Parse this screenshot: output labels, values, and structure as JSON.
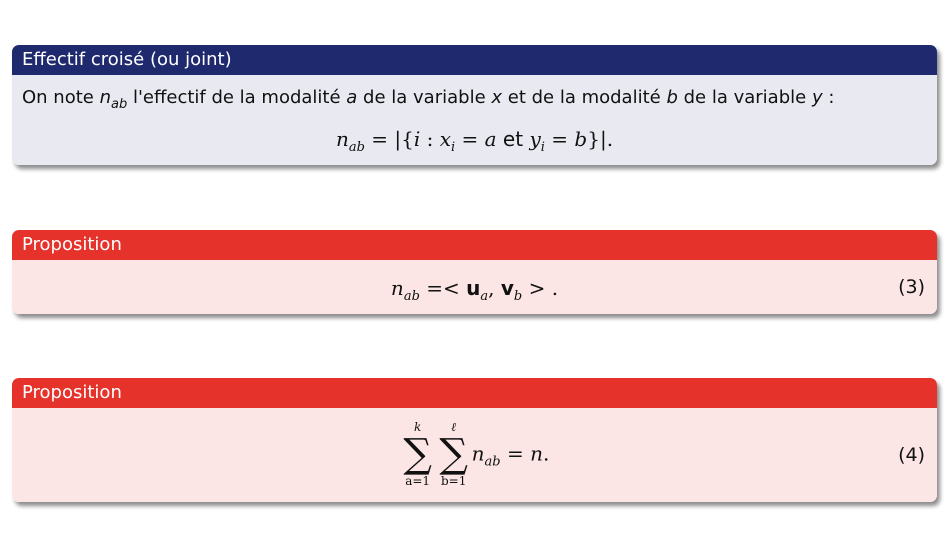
{
  "definition": {
    "title": "Effectif croisé (ou joint)",
    "intro": {
      "p1": "On note ",
      "n": "n",
      "ab": "ab",
      "p2": " l'effectif de la modalité ",
      "a": "a",
      "p3": " de la variable ",
      "x": "x",
      "p4": " et de la modalité ",
      "b": "b",
      "p5": " de la variable ",
      "y": "y",
      "p6": " :"
    },
    "formula": {
      "n": "n",
      "ab": "ab",
      "p1": " = |{",
      "i": "i",
      "p2": " : ",
      "x": "x",
      "i2": "i",
      "p3": " = ",
      "a": "a",
      "et": " et ",
      "y": "y",
      "i3": "i",
      "p4": " = ",
      "b": "b",
      "p5": "}|."
    }
  },
  "proposition1": {
    "title": "Proposition",
    "formula": {
      "n": "n",
      "ab": "ab",
      "p1": " =< ",
      "u": "u",
      "a": "a",
      "comma": ", ",
      "v": "v",
      "b": "b",
      "p2": " > ."
    },
    "number": "(3)"
  },
  "proposition2": {
    "title": "Proposition",
    "formula": {
      "sum1_top": "k",
      "sum1_bottom": "a=1",
      "sum2_top": "ℓ",
      "sum2_bottom": "b=1",
      "sigma": "∑",
      "n": "n",
      "ab": "ab",
      "p1": " = ",
      "nn": "n",
      "p2": "."
    },
    "number": "(4)"
  }
}
